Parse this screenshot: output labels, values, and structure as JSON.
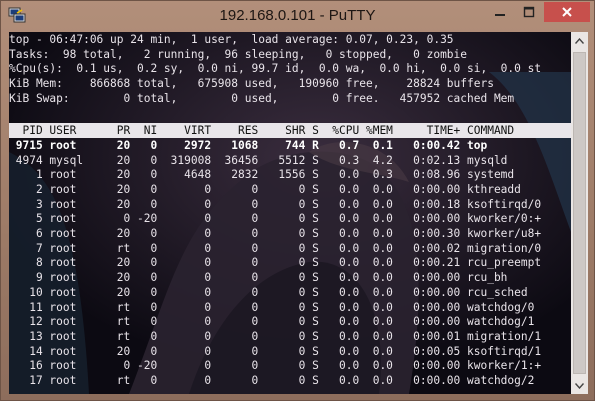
{
  "window": {
    "title": "192.168.0.101 - PuTTY",
    "icon": "putty-icon",
    "controls": {
      "minimize": "minimize-icon",
      "maximize": "maximize-icon",
      "close": "close-icon"
    }
  },
  "colors": {
    "terminal_bg": "#0c0a12",
    "terminal_fg": "#e9e4ea",
    "header_bar": "#e9e6ea",
    "close_button": "#c7504c"
  },
  "summary": [
    "top - 06:47:06 up 24 min,  1 user,  load average: 0.07, 0.23, 0.35",
    "Tasks:  98 total,   2 running,  96 sleeping,   0 stopped,   0 zombie",
    "%Cpu(s):  0.1 us,  0.2 sy,  0.0 ni, 99.7 id,  0.0 wa,  0.0 hi,  0.0 si,  0.0 st",
    "KiB Mem:    866868 total,   675908 used,   190960 free,    28824 buffers",
    "KiB Swap:        0 total,        0 used,        0 free.   457952 cached Mem"
  ],
  "table_header": "  PID USER      PR  NI    VIRT    RES    SHR S  %CPU %MEM     TIME+ COMMAND",
  "processes": [
    {
      "text": " 9715 root      20   0    2972   1068    744 R   0.7  0.1   0:00.42 top",
      "bold": true
    },
    {
      "text": " 4974 mysql     20   0  319008  36456   5512 S   0.3  4.2   0:02.13 mysqld",
      "bold": false
    },
    {
      "text": "    1 root      20   0    4648   2832   1556 S   0.0  0.3   0:08.96 systemd",
      "bold": false
    },
    {
      "text": "    2 root      20   0       0      0      0 S   0.0  0.0   0:00.00 kthreadd",
      "bold": false
    },
    {
      "text": "    3 root      20   0       0      0      0 S   0.0  0.0   0:00.18 ksoftirqd/0",
      "bold": false
    },
    {
      "text": "    5 root       0 -20       0      0      0 S   0.0  0.0   0:00.00 kworker/0:+",
      "bold": false
    },
    {
      "text": "    6 root      20   0       0      0      0 S   0.0  0.0   0:00.30 kworker/u8+",
      "bold": false
    },
    {
      "text": "    7 root      rt   0       0      0      0 S   0.0  0.0   0:00.02 migration/0",
      "bold": false
    },
    {
      "text": "    8 root      20   0       0      0      0 S   0.0  0.0   0:00.21 rcu_preempt",
      "bold": false
    },
    {
      "text": "    9 root      20   0       0      0      0 S   0.0  0.0   0:00.00 rcu_bh",
      "bold": false
    },
    {
      "text": "   10 root      20   0       0      0      0 S   0.0  0.0   0:00.00 rcu_sched",
      "bold": false
    },
    {
      "text": "   11 root      rt   0       0      0      0 S   0.0  0.0   0:00.00 watchdog/0",
      "bold": false
    },
    {
      "text": "   12 root      rt   0       0      0      0 S   0.0  0.0   0:00.00 watchdog/1",
      "bold": false
    },
    {
      "text": "   13 root      rt   0       0      0      0 S   0.0  0.0   0:00.01 migration/1",
      "bold": false
    },
    {
      "text": "   14 root      20   0       0      0      0 S   0.0  0.0   0:00.05 ksoftirqd/1",
      "bold": false
    },
    {
      "text": "   16 root       0 -20       0      0      0 S   0.0  0.0   0:00.00 kworker/1:+",
      "bold": false
    },
    {
      "text": "   17 root      rt   0       0      0      0 S   0.0  0.0   0:00.00 watchdog/2",
      "bold": false
    }
  ],
  "scrollbar": {
    "up": "arrow-up-icon",
    "down": "arrow-down-icon"
  }
}
